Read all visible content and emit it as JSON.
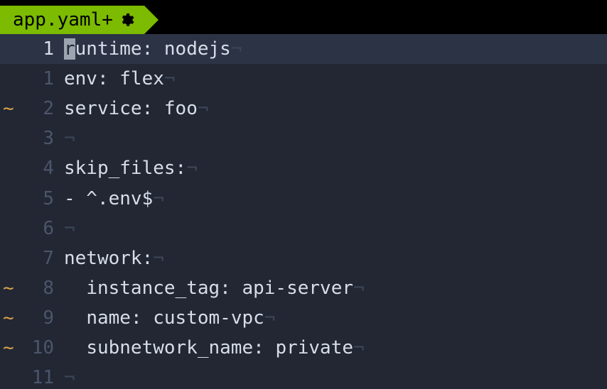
{
  "tab": {
    "filename": "app.yaml+",
    "icon": "gear-icon"
  },
  "editor": {
    "lines": [
      {
        "sign": "",
        "num": "1",
        "current": true,
        "indent": "",
        "key": "runtime",
        "val": "nodejs",
        "cursor_on_first_char": true
      },
      {
        "sign": "",
        "num": "1",
        "current": false,
        "indent": "",
        "key": "env",
        "val": "flex"
      },
      {
        "sign": "~",
        "num": "2",
        "current": false,
        "indent": "",
        "key": "service",
        "val": "foo"
      },
      {
        "sign": "",
        "num": "3",
        "current": false,
        "blank": true
      },
      {
        "sign": "",
        "num": "4",
        "current": false,
        "indent": "",
        "key": "skip_files",
        "val": ""
      },
      {
        "sign": "",
        "num": "5",
        "current": false,
        "raw": "- ^.env$"
      },
      {
        "sign": "",
        "num": "6",
        "current": false,
        "blank": true
      },
      {
        "sign": "",
        "num": "7",
        "current": false,
        "indent": "",
        "key": "network",
        "val": ""
      },
      {
        "sign": "~",
        "num": "8",
        "current": false,
        "indent": "  ",
        "key": "instance_tag",
        "val": "api-server"
      },
      {
        "sign": "~",
        "num": "9",
        "current": false,
        "indent": "  ",
        "key": "name",
        "val": "custom-vpc"
      },
      {
        "sign": "~",
        "num": "10",
        "current": false,
        "indent": "  ",
        "key": "subnetwork_name",
        "val": "private"
      },
      {
        "sign": "",
        "num": "11",
        "current": false,
        "blank": true
      }
    ],
    "invisible_eol": "¬"
  }
}
